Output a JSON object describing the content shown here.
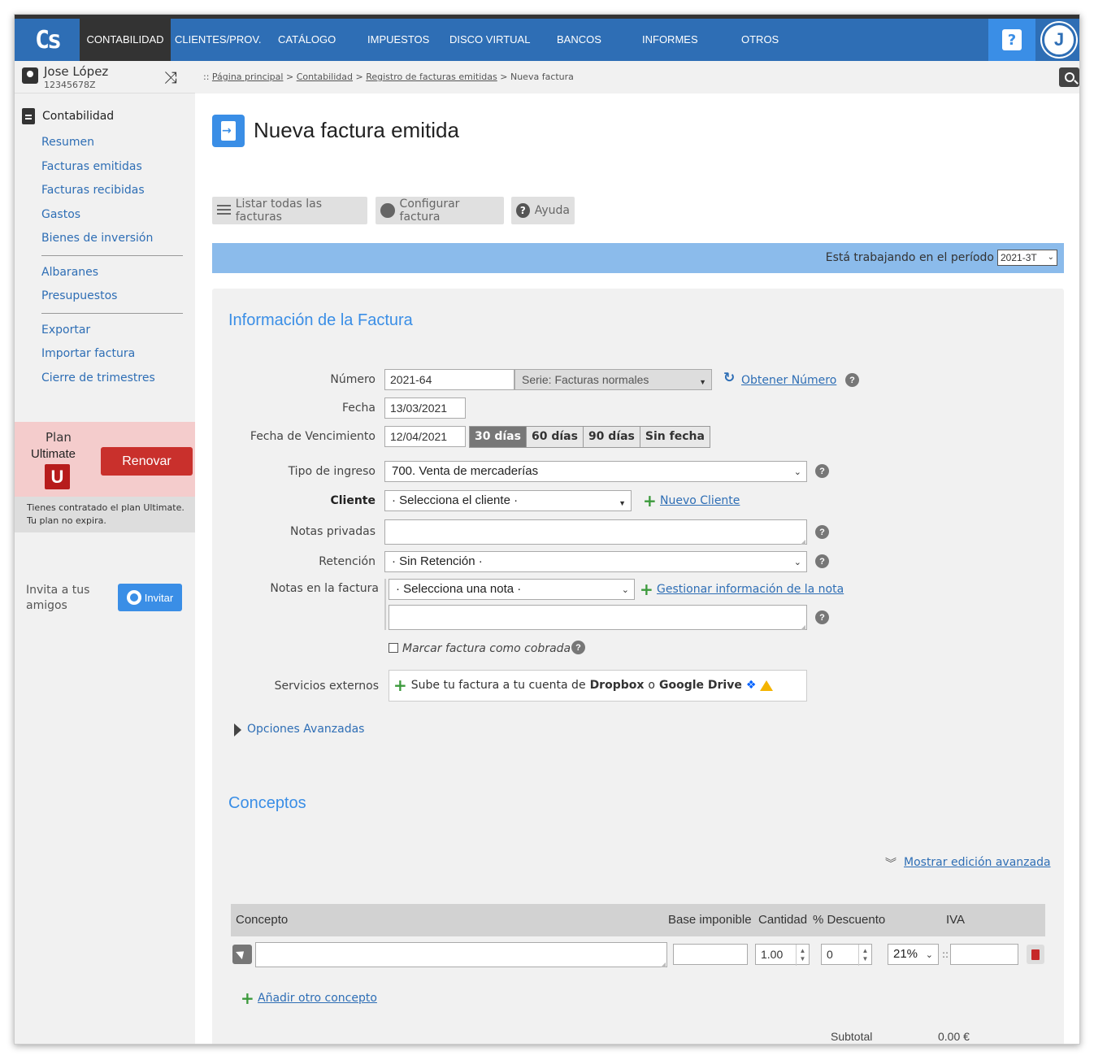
{
  "app": {
    "logo": "Cs"
  },
  "nav": {
    "items": [
      "CONTABILIDAD",
      "CLIENTES/PROV.",
      "CATÁLOGO",
      "IMPUESTOS",
      "DISCO VIRTUAL",
      "BANCOS",
      "INFORMES",
      "OTROS"
    ],
    "active": "CONTABILIDAD",
    "help_icon": "question-icon",
    "avatar_letter": "J"
  },
  "user": {
    "name": "Jose López",
    "id": "12345678Z"
  },
  "breadcrumb": {
    "prefix": "::",
    "items": [
      "Página principal",
      "Contabilidad",
      "Registro de facturas emitidas"
    ],
    "current": "Nueva factura"
  },
  "sidebar": {
    "title": "Contabilidad",
    "group1": [
      "Resumen",
      "Facturas emitidas",
      "Facturas recibidas",
      "Gastos",
      "Bienes de inversión"
    ],
    "group2": [
      "Albaranes",
      "Presupuestos"
    ],
    "group3": [
      "Exportar",
      "Importar factura",
      "Cierre de trimestres"
    ],
    "plan": {
      "label": "Plan",
      "name": "Ultimate",
      "badge": "U",
      "renew": "Renovar",
      "note1": "Tienes contratado el plan Ultimate.",
      "note2": "Tu plan no expira."
    },
    "invite": {
      "text": "Invita a tus amigos",
      "button": "Invitar"
    }
  },
  "page": {
    "title": "Nueva factura emitida",
    "toolbar": {
      "list": "Listar todas las facturas",
      "config": "Configurar factura",
      "help": "Ayuda"
    },
    "period": {
      "text": "Está trabajando en el período",
      "value": "2021-3T"
    }
  },
  "form": {
    "section_title": "Información de la Factura",
    "numero": {
      "label": "Número",
      "value": "2021-64",
      "serie": "Serie: Facturas normales",
      "obtener": "Obtener Número"
    },
    "fecha": {
      "label": "Fecha",
      "value": "13/03/2021"
    },
    "vencimiento": {
      "label": "Fecha de Vencimiento",
      "value": "12/04/2021",
      "options": [
        "30 días",
        "60 días",
        "90 días",
        "Sin fecha"
      ],
      "active": "30 días"
    },
    "tipo_ingreso": {
      "label": "Tipo de ingreso",
      "value": "700. Venta de mercaderías"
    },
    "cliente": {
      "label": "Cliente",
      "value": "· Selecciona el cliente ·",
      "nuevo": "Nuevo Cliente"
    },
    "notas_privadas": {
      "label": "Notas privadas"
    },
    "retencion": {
      "label": "Retención",
      "value": "· Sin Retención ·"
    },
    "notas_factura": {
      "label": "Notas en la factura",
      "value": "· Selecciona una nota ·",
      "gestionar": "Gestionar información de la nota"
    },
    "cobrada": {
      "label": "Marcar factura como cobrada"
    },
    "servicios": {
      "label": "Servicios externos",
      "text_pre": "Sube tu factura a tu cuenta de",
      "dropbox": "Dropbox",
      "o": "o",
      "gdrive": "Google Drive"
    },
    "avanzadas": "Opciones Avanzadas"
  },
  "conceptos": {
    "title": "Conceptos",
    "mostrar": "Mostrar edición avanzada",
    "columns": [
      "Concepto",
      "Base imponible",
      "Cantidad",
      "% Descuento",
      "IVA"
    ],
    "row": {
      "cantidad": "1.00",
      "descuento": "0",
      "iva": "21%",
      "sep": "::"
    },
    "anadir": "Añadir otro concepto",
    "subtotal_label": "Subtotal",
    "subtotal_value": "0.00 €"
  },
  "colors": {
    "nav": "#2e6eb5",
    "accent": "#3a8ee6",
    "renew": "#c9302c",
    "plan_bg": "#f4cccc",
    "period_bar": "#8bbbeb"
  }
}
